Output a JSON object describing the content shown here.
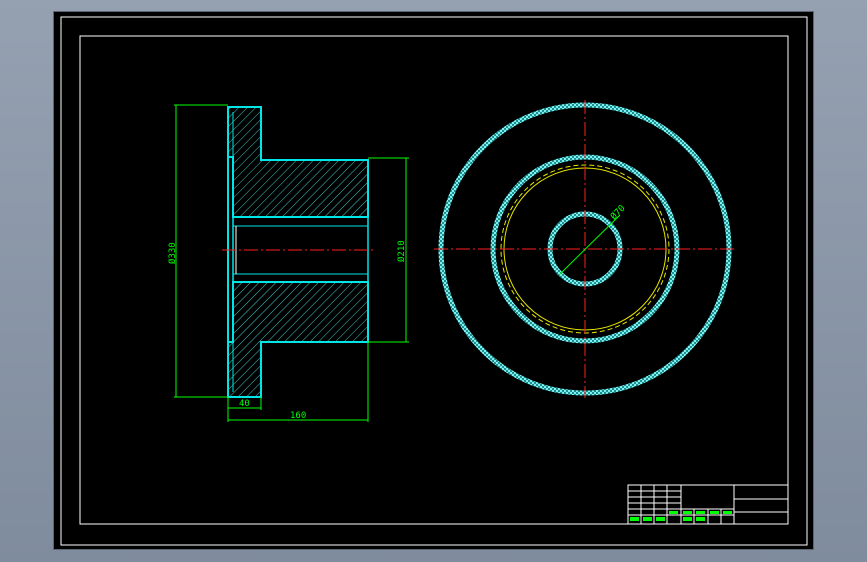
{
  "drawing": {
    "dimensions": {
      "outer_diameter": "Ø330",
      "hub_diameter": "Ø210",
      "bore_diameter": "Ø70",
      "flange_thickness": "40",
      "overall_length": "160"
    }
  },
  "colors": {
    "background": "#000000",
    "border": "#ffffff",
    "outline": "#00e6e6",
    "hatch": "#3fc8c8",
    "dimension": "#00ff00",
    "centerline": "#ff2020",
    "hidden": "#e6e600"
  }
}
